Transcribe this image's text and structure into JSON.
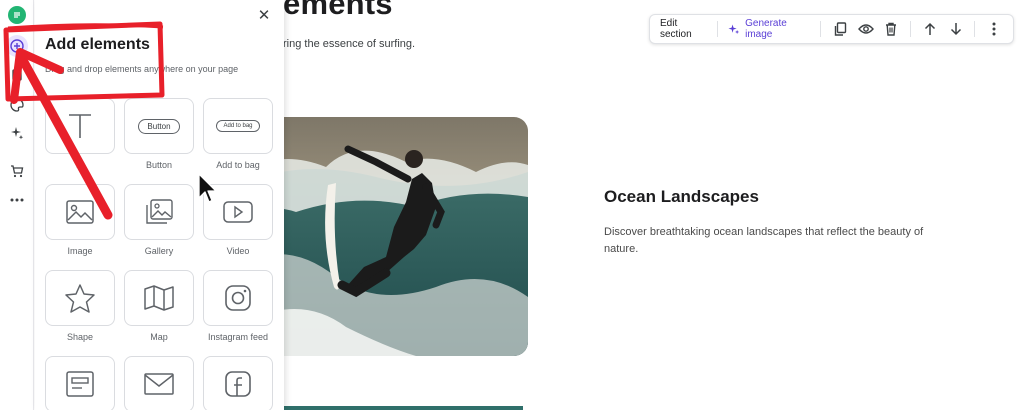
{
  "page": {
    "title_fragment": "ements",
    "subtitle_fragment": "ring the essence of surfing."
  },
  "section": {
    "heading": "Ocean Landscapes",
    "body": "Discover breathtaking ocean landscapes that reflect the beauty of nature."
  },
  "toolbar": {
    "edit_section": "Edit section",
    "generate_image": "Generate image",
    "icons": [
      "duplicate-icon",
      "eye-icon",
      "trash-icon",
      "arrow-up-icon",
      "arrow-down-icon",
      "more-vertical-icon"
    ]
  },
  "panel": {
    "title": "Add elements",
    "subtitle": "Drag and drop elements anywhere on your page",
    "tiles": [
      {
        "label": "Text",
        "shown": "xt",
        "icon": "text-icon"
      },
      {
        "label": "Button",
        "pill": "Button",
        "icon": "button-preview"
      },
      {
        "label": "Add to bag",
        "pill": "Add to bag",
        "icon": "add-to-bag-preview"
      },
      {
        "label": "Image",
        "icon": "image-icon"
      },
      {
        "label": "Gallery",
        "icon": "gallery-icon"
      },
      {
        "label": "Video",
        "icon": "video-icon"
      },
      {
        "label": "Shape",
        "icon": "star-icon"
      },
      {
        "label": "Map",
        "icon": "map-icon"
      },
      {
        "label": "Instagram feed",
        "icon": "instagram-icon"
      },
      {
        "label": "",
        "icon": "form-icon"
      },
      {
        "label": "",
        "icon": "mail-icon"
      },
      {
        "label": "",
        "icon": "facebook-icon"
      }
    ]
  },
  "rail": {
    "icons": [
      "logo-icon",
      "add-icon",
      "pages-icon",
      "theme-icon",
      "ai-sparkle-icon",
      "cart-icon",
      "more-horizontal-icon"
    ]
  },
  "colors": {
    "accent": "#5a3fd6",
    "annotation": "#e8202a",
    "logo": "#22b573"
  }
}
